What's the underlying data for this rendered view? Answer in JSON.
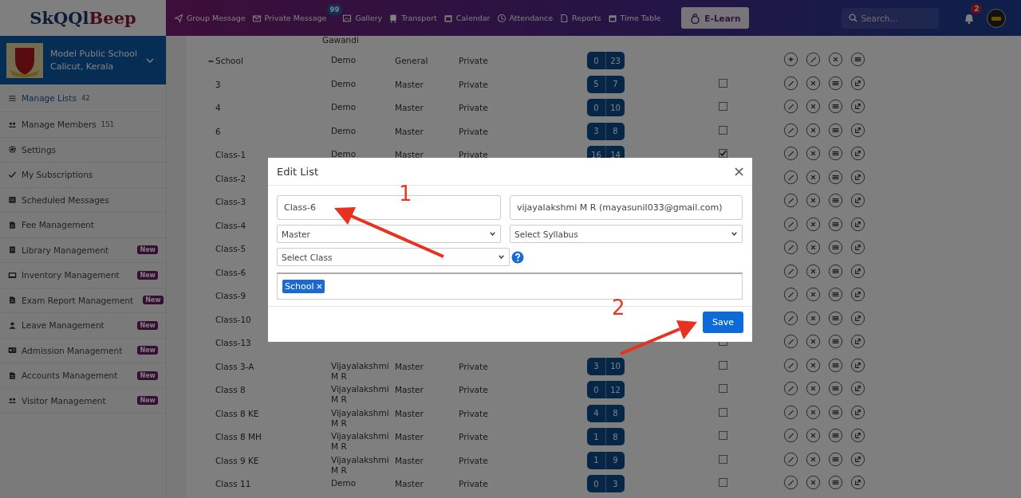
{
  "topbar": {
    "logo_a": "SkQQl",
    "logo_b": "Beep",
    "nav": [
      {
        "label": "Group Message"
      },
      {
        "label": "Private Message",
        "badge": "99"
      },
      {
        "label": "Gallery"
      },
      {
        "label": "Transport"
      },
      {
        "label": "Calendar"
      },
      {
        "label": "Attendance"
      },
      {
        "label": "Reports"
      },
      {
        "label": "Time Table"
      }
    ],
    "elearn": "E-Learn",
    "search": {
      "placeholder": "Search..."
    },
    "notifications": "2"
  },
  "sidebar": {
    "school": {
      "name": "Model Public School",
      "location": "Calicut, Kerala"
    },
    "items": [
      {
        "label": "Manage Lists",
        "count": "42",
        "selected": true
      },
      {
        "label": "Manage Members",
        "count": "151",
        "selected": false
      },
      {
        "label": "Settings",
        "selected": false
      },
      {
        "label": "My Subscriptions",
        "selected": false
      },
      {
        "label": "Scheduled Messages",
        "selected": false
      },
      {
        "label": "Fee Management",
        "selected": false
      },
      {
        "label": "Library Management",
        "badge": "New",
        "selected": false
      },
      {
        "label": "Inventory Management",
        "badge": "New",
        "selected": false
      },
      {
        "label": "Exam Report Management",
        "badge": "New",
        "selected": false
      },
      {
        "label": "Leave Management",
        "badge": "New",
        "selected": false
      },
      {
        "label": "Admission Management",
        "badge": "New",
        "selected": false
      },
      {
        "label": "Accounts Management",
        "badge": "New",
        "selected": false
      },
      {
        "label": "Visitor Management",
        "badge": "New",
        "selected": false
      }
    ]
  },
  "table": {
    "rows": [
      {
        "kind": "tail",
        "owner": "Gawandi"
      },
      {
        "kind": "group",
        "expanded": true,
        "name": "School",
        "owner": "Demo",
        "type": "General",
        "privacy": "Private",
        "counts": [
          "0",
          "23"
        ]
      },
      {
        "kind": "list",
        "name": "3",
        "owner": "Demo",
        "type": "Master",
        "privacy": "Private",
        "counts": [
          "5",
          "7"
        ],
        "checked": false
      },
      {
        "kind": "list",
        "name": "4",
        "owner": "Demo",
        "type": "Master",
        "privacy": "Private",
        "counts": [
          "0",
          "10"
        ],
        "checked": false
      },
      {
        "kind": "list",
        "name": "6",
        "owner": "Demo",
        "type": "Master",
        "privacy": "Private",
        "counts": [
          "3",
          "8"
        ],
        "checked": false
      },
      {
        "kind": "list",
        "name": "Class-1",
        "owner": "Demo",
        "type": "Master",
        "privacy": "Private",
        "counts": [
          "16",
          "14"
        ],
        "checked": true
      },
      {
        "kind": "list",
        "name": "Class-2"
      },
      {
        "kind": "list",
        "name": "Class-3"
      },
      {
        "kind": "list",
        "name": "Class-4"
      },
      {
        "kind": "list",
        "name": "Class-5"
      },
      {
        "kind": "list",
        "name": "Class-6"
      },
      {
        "kind": "list",
        "name": "Class-9"
      },
      {
        "kind": "list",
        "name": "Class-10"
      },
      {
        "kind": "list",
        "name": "Class-13",
        "checked": false
      },
      {
        "kind": "list",
        "name": "Class 3-A",
        "owner": "Vijayalakshmi M R",
        "type": "Master",
        "privacy": "Private",
        "counts": [
          "3",
          "10"
        ],
        "checked": false
      },
      {
        "kind": "list",
        "name": "Class 8",
        "owner": "Vijayalakshmi M R",
        "type": "Master",
        "privacy": "Private",
        "counts": [
          "0",
          "12"
        ],
        "checked": false
      },
      {
        "kind": "list",
        "name": "Class 8 KE",
        "owner": "Vijayalakshmi M R",
        "type": "Master",
        "privacy": "Private",
        "counts": [
          "4",
          "8"
        ],
        "checked": false
      },
      {
        "kind": "list",
        "name": "Class 8 MH",
        "owner": "Vijayalakshmi M R",
        "type": "Master",
        "privacy": "Private",
        "counts": [
          "1",
          "8"
        ],
        "checked": false
      },
      {
        "kind": "list",
        "name": "Class 9 KE",
        "owner": "Vijayalakshmi M R",
        "type": "Master",
        "privacy": "Private",
        "counts": [
          "1",
          "9"
        ],
        "checked": false
      },
      {
        "kind": "list",
        "name": "Class 11",
        "owner": "Demo",
        "type": "Master",
        "privacy": "Private",
        "counts": [
          "0",
          "3"
        ],
        "checked": false
      }
    ]
  },
  "modal": {
    "title": "Edit List",
    "fields": [
      {
        "kind": "input",
        "value": "Class-6"
      },
      {
        "kind": "input",
        "value": "vijayalakshmi M R (mayasunil033@gmail.com)"
      },
      {
        "kind": "select",
        "value": "Master"
      },
      {
        "kind": "select",
        "value": "Select Syllabus"
      },
      {
        "kind": "select",
        "value": "Select Class",
        "help": true
      }
    ],
    "tags": [
      "School"
    ],
    "save": "Save"
  },
  "annotations": [
    {
      "label": "1"
    },
    {
      "label": "2"
    }
  ]
}
